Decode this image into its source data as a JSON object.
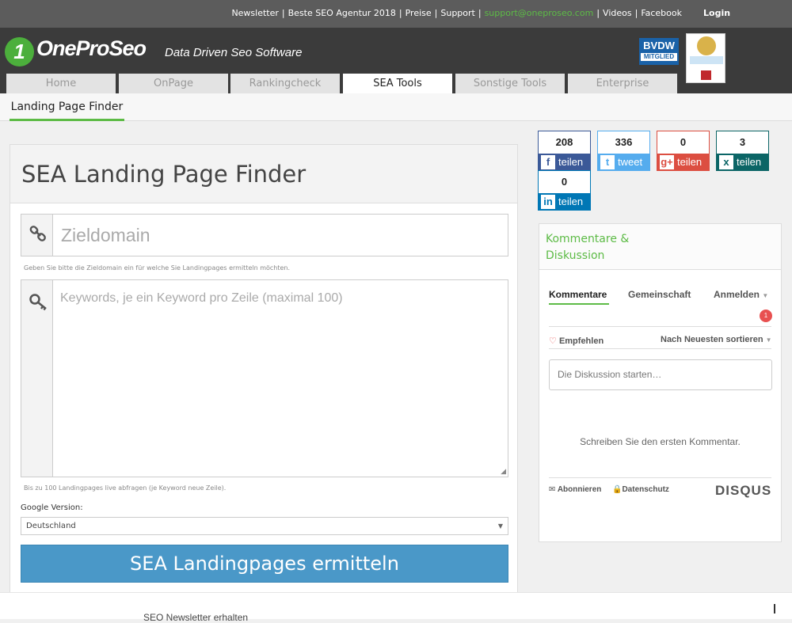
{
  "topbar": {
    "links": [
      "Newsletter",
      "Beste SEO Agentur 2018",
      "Preise",
      "Support",
      "support@oneproseo.com",
      "Videos",
      "Facebook"
    ],
    "login": "Login"
  },
  "header": {
    "logo_mark": "1",
    "logo_text": "OneProSeo",
    "tagline": "Data Driven Seo Software",
    "badge_top": "BVDW",
    "badge_bottom": "MITGLIED"
  },
  "tabs": [
    "Home",
    "OnPage",
    "Rankingcheck",
    "SEA Tools",
    "Sonstige Tools",
    "Enterprise"
  ],
  "subnav": {
    "item": "Landing Page Finder"
  },
  "main": {
    "title": "SEA Landing Page Finder",
    "domain_placeholder": "Zieldomain",
    "domain_help": "Geben Sie bitte die Zieldomain ein für welche Sie Landingpages ermitteln möchten.",
    "keywords_placeholder": "Keywords, je ein Keyword pro Zeile (maximal 100)",
    "keywords_help": "Bis zu 100 Landingpages live abfragen (je Keyword neue Zeile).",
    "google_label": "Google Version:",
    "google_value": "Deutschland",
    "submit": "SEA Landingpages ermitteln"
  },
  "share": [
    {
      "count": "208",
      "label": "teilen",
      "glyph": "f",
      "color": "#3b5998",
      "icon": "facebook-icon"
    },
    {
      "count": "336",
      "label": "tweet",
      "glyph": "t",
      "color": "#55acee",
      "icon": "twitter-icon"
    },
    {
      "count": "0",
      "label": "teilen",
      "glyph": "g+",
      "color": "#dc4e41",
      "icon": "google-plus-icon"
    },
    {
      "count": "3",
      "label": "teilen",
      "glyph": "x",
      "color": "#0b6566",
      "icon": "xing-icon"
    },
    {
      "count": "0",
      "label": "teilen",
      "glyph": "in",
      "color": "#0077b5",
      "icon": "linkedin-icon"
    }
  ],
  "comments": {
    "title": "Kommentare & Diskussion",
    "tabs": [
      "Kommentare",
      "Gemeinschaft",
      "Anmelden"
    ],
    "notification_count": "1",
    "recommend": "Empfehlen",
    "sort": "Nach Neuesten sortieren",
    "input_placeholder": "Die Diskussion starten…",
    "empty": "Schreiben Sie den ersten Kommentar.",
    "subscribe": "Abonnieren",
    "privacy": "Datenschutz",
    "brand": "DISQUS"
  },
  "footer": {
    "text": "SEO Newsletter erhalten"
  }
}
